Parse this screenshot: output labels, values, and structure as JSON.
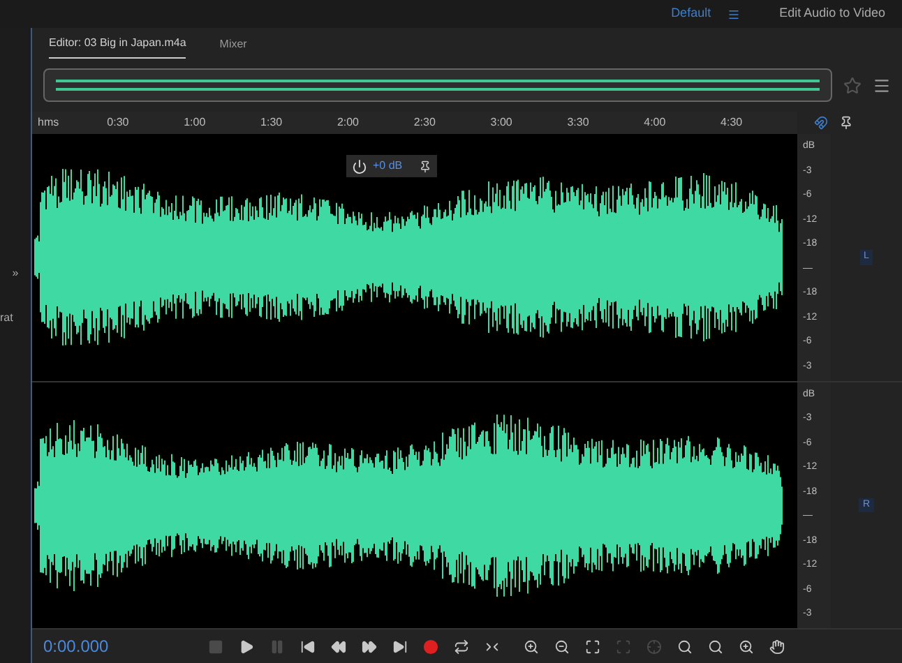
{
  "top_bar": {
    "workspace": "Default",
    "button": "Edit Audio to Video"
  },
  "left_panel": {
    "texts": [
      "»",
      "rat"
    ]
  },
  "tabs": [
    {
      "label": "Editor: 03 Big in Japan.m4a",
      "selected": true
    },
    {
      "label": "Mixer",
      "selected": false
    }
  ],
  "ruler": {
    "unit": "hms",
    "ticks": [
      "0:30",
      "1:00",
      "1:30",
      "2:00",
      "2:30",
      "3:00",
      "3:30",
      "4:00",
      "4:30"
    ]
  },
  "hud": {
    "gain": "+0 dB"
  },
  "channels": [
    {
      "label": "L",
      "db_scale": [
        "dB",
        "-3",
        "-6",
        "-12",
        "-18",
        "—",
        "-18",
        "-12",
        "-6",
        "-3"
      ]
    },
    {
      "label": "R",
      "db_scale": [
        "dB",
        "-3",
        "-6",
        "-12",
        "-18",
        "—",
        "-18",
        "-12",
        "-6",
        "-3"
      ]
    }
  ],
  "transport": {
    "time": "0:00.000",
    "buttons": [
      {
        "kind": "stop",
        "disabled": true
      },
      {
        "kind": "play",
        "disabled": false
      },
      {
        "kind": "pause",
        "disabled": true
      },
      {
        "kind": "start",
        "disabled": false
      },
      {
        "kind": "rewind",
        "disabled": false
      },
      {
        "kind": "forward",
        "disabled": false
      },
      {
        "kind": "end",
        "disabled": false
      },
      {
        "kind": "record",
        "disabled": false
      },
      {
        "kind": "loop",
        "disabled": false
      },
      {
        "kind": "skip",
        "disabled": false
      }
    ],
    "zoom_buttons": [
      {
        "kind": "zoom-in",
        "disabled": false
      },
      {
        "kind": "zoom-out",
        "disabled": false
      },
      {
        "kind": "zoom-full",
        "disabled": false
      },
      {
        "kind": "zoom-selection",
        "disabled": true
      },
      {
        "kind": "zoom-point",
        "disabled": true
      },
      {
        "kind": "zoom-in-left",
        "disabled": false
      },
      {
        "kind": "zoom-in-right",
        "disabled": false
      },
      {
        "kind": "zoom-both",
        "disabled": false
      },
      {
        "kind": "zoom-hand",
        "disabled": false
      }
    ]
  }
}
